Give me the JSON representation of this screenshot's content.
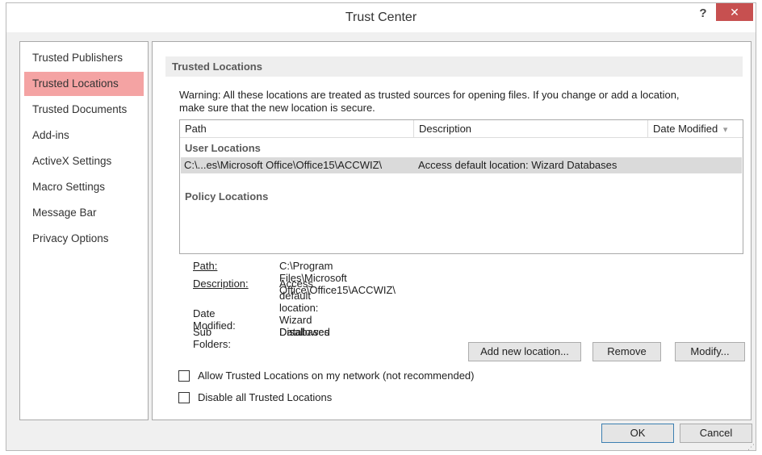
{
  "window": {
    "title": "Trust Center",
    "help_label": "?",
    "close_label": "✕"
  },
  "sidebar": {
    "items": [
      {
        "label": "Trusted Publishers"
      },
      {
        "label": "Trusted Locations"
      },
      {
        "label": "Trusted Documents"
      },
      {
        "label": "Add-ins"
      },
      {
        "label": "ActiveX Settings"
      },
      {
        "label": "Macro Settings"
      },
      {
        "label": "Message Bar"
      },
      {
        "label": "Privacy Options"
      }
    ]
  },
  "main": {
    "header": "Trusted Locations",
    "warning_line1": "Warning: All these locations are treated as trusted sources for opening files.  If you change or add a location,",
    "warning_line2": "make sure that the new location is secure.",
    "columns": {
      "path": "Path",
      "description": "Description",
      "date_modified": "Date Modified"
    },
    "sort_indicator": "▾",
    "user_group": "User Locations",
    "rows": [
      {
        "path": "C:\\...es\\Microsoft Office\\Office15\\ACCWIZ\\",
        "description": "Access default location: Wizard Databases",
        "date": ""
      }
    ],
    "policy_group": "Policy Locations",
    "details": {
      "path_label": "Path:",
      "path_value": "C:\\Program Files\\Microsoft Office\\Office15\\ACCWIZ\\",
      "description_label": "Description:",
      "description_value": "Access default location: Wizard Databases",
      "date_label": "Date Modified:",
      "date_value": "",
      "subfolders_label": "Sub Folders:",
      "subfolders_value": "Disallowed"
    },
    "buttons": {
      "add": "Add new location...",
      "remove": "Remove",
      "modify": "Modify..."
    },
    "checkboxes": {
      "allow_network": {
        "label": "Allow Trusted Locations on my network (not recommended)",
        "checked": false
      },
      "disable_all": {
        "label": "Disable all Trusted Locations",
        "checked": false
      }
    }
  },
  "footer": {
    "ok": "OK",
    "cancel": "Cancel"
  },
  "colors": {
    "selected_nav": "#f4a3a3",
    "close_button": "#c75050",
    "selected_row": "#dadada"
  }
}
